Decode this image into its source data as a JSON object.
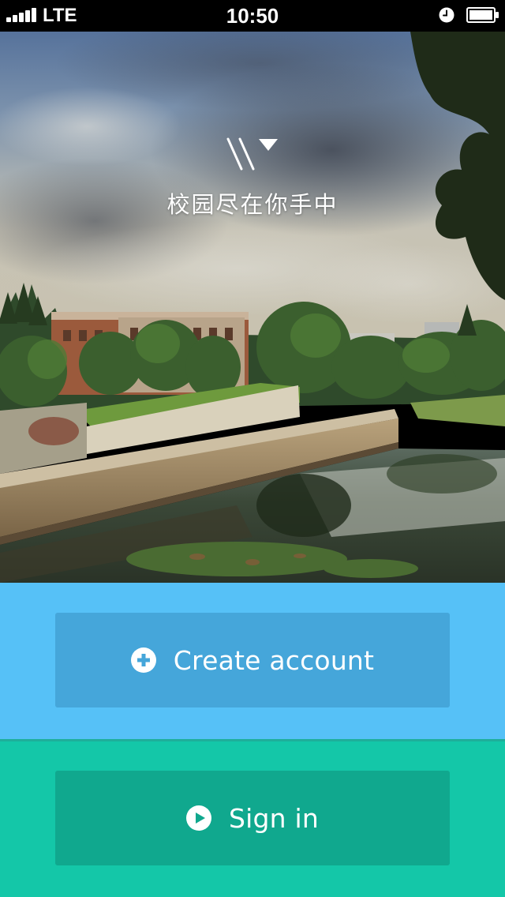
{
  "status_bar": {
    "carrier": "LTE",
    "time": "10:50",
    "signal_bars": 5,
    "icons": [
      "signal-icon",
      "alarm-icon",
      "battery-icon"
    ]
  },
  "hero": {
    "logo": "app-logo-icon",
    "tagline": "校园尽在你手中"
  },
  "actions": {
    "create_account": {
      "label": "Create account",
      "icon": "plus-circle-icon"
    },
    "sign_in": {
      "label": "Sign in",
      "icon": "play-circle-icon"
    }
  },
  "colors": {
    "create_panel": "#56c1f7",
    "create_button": "#45a6da",
    "signin_panel": "#14c7a8",
    "signin_button": "#10a88e",
    "status_bar": "#000000"
  }
}
